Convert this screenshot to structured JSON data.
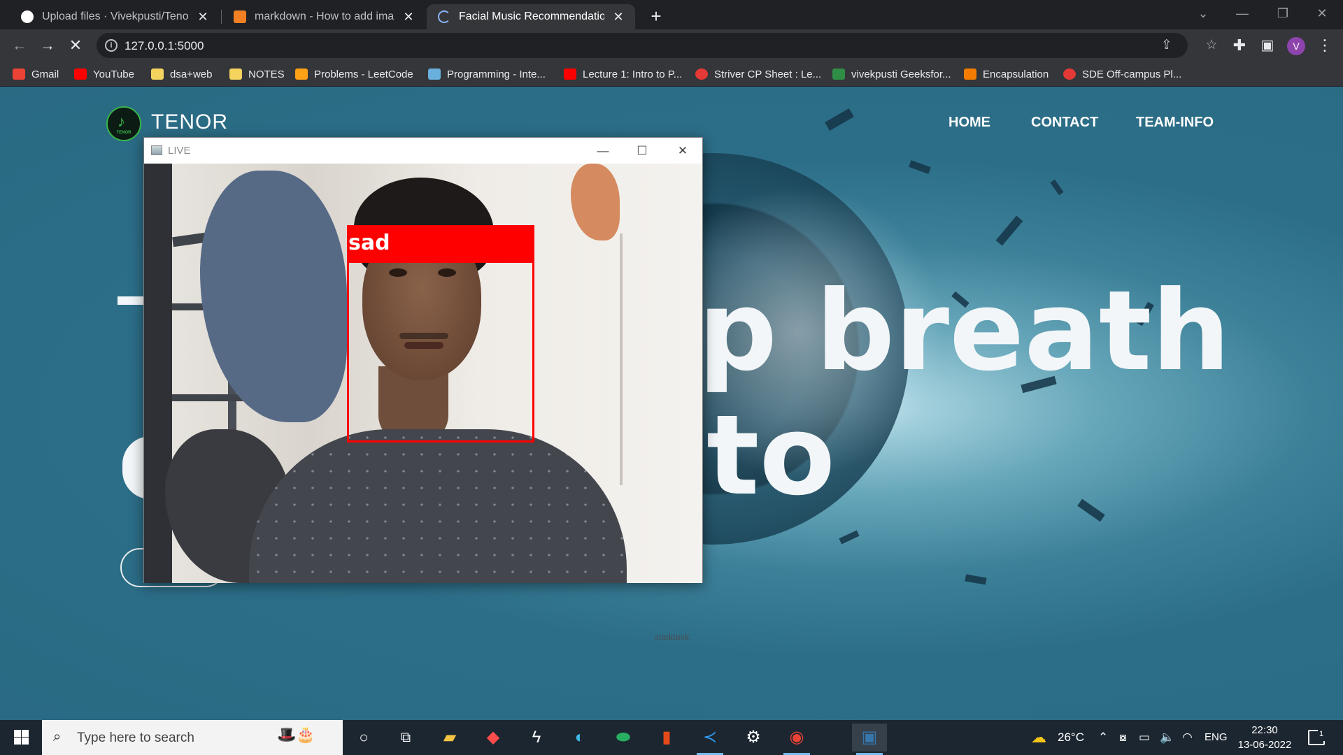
{
  "browser": {
    "tabs": [
      {
        "title": "Upload files · Vivekpusti/Tenor",
        "favicon": "github-icon",
        "active": false
      },
      {
        "title": "markdown - How to add images",
        "favicon": "stackoverflow-icon",
        "active": false
      },
      {
        "title": "Facial Music Recommendation",
        "favicon": "loading-icon",
        "active": true
      }
    ],
    "new_tab_label": "+",
    "url": "127.0.0.1:5000",
    "profile_initial": "V",
    "bookmarks": [
      {
        "label": "Gmail",
        "icon": "gmail-icon",
        "color": "#ea4335"
      },
      {
        "label": "YouTube",
        "icon": "youtube-icon",
        "color": "#ff0000"
      },
      {
        "label": "dsa+web",
        "icon": "folder-icon",
        "color": "#f4d35e"
      },
      {
        "label": "NOTES",
        "icon": "folder-icon",
        "color": "#f4d35e"
      },
      {
        "label": "Problems - LeetCode",
        "icon": "leetcode-icon",
        "color": "#ffa116"
      },
      {
        "label": "Programming - Inte...",
        "icon": "mountain-icon",
        "color": "#6ab0de"
      },
      {
        "label": "Lecture 1: Intro to P...",
        "icon": "youtube-icon",
        "color": "#ff0000"
      },
      {
        "label": "Striver CP Sheet : Le...",
        "icon": "tuf-icon",
        "color": "#e53935"
      },
      {
        "label": "vivekpusti Geeksfor...",
        "icon": "gfg-icon",
        "color": "#2f8d46"
      },
      {
        "label": "Encapsulation",
        "icon": "codingninjas-icon",
        "color": "#f57c00"
      },
      {
        "label": "SDE Off-campus Pl...",
        "icon": "tuf-icon",
        "color": "#e53935"
      }
    ]
  },
  "site": {
    "brand": "TENOR",
    "logo_text": "TENOR",
    "nav": [
      "HOME",
      "CONTACT",
      "TEAM-INFO"
    ],
    "hero_line1_fragment": "p breath",
    "hero_line2_fragment": "to",
    "credit": "simkinsk"
  },
  "live_window": {
    "title": "LIVE",
    "emotion_label": "sad"
  },
  "taskbar": {
    "search_placeholder": "Type here to search",
    "weather": "26°C",
    "language": "ENG",
    "time": "22:30",
    "date": "13-06-2022",
    "notification_count": "1"
  }
}
